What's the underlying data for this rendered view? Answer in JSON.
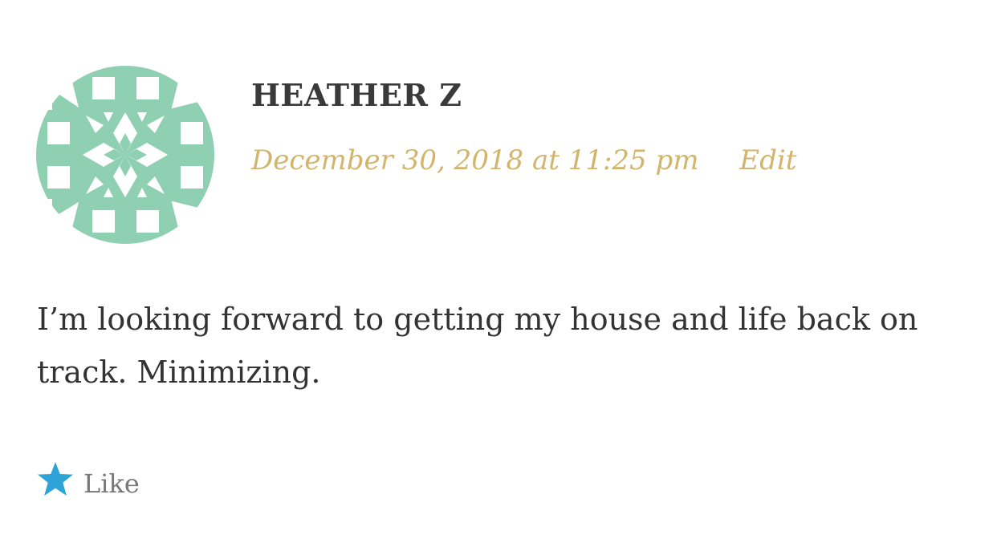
{
  "comment": {
    "author": "HEATHER Z",
    "date": "December 30, 2018 at 11:25 pm",
    "edit_label": "Edit",
    "text": "I’m looking forward to getting my house and life back on track. Minimizing.",
    "like_label": "Like"
  },
  "colors": {
    "avatar": "#8fd0b3",
    "meta": "#d2b56a",
    "star": "#2ea3d7",
    "text": "#333333"
  }
}
